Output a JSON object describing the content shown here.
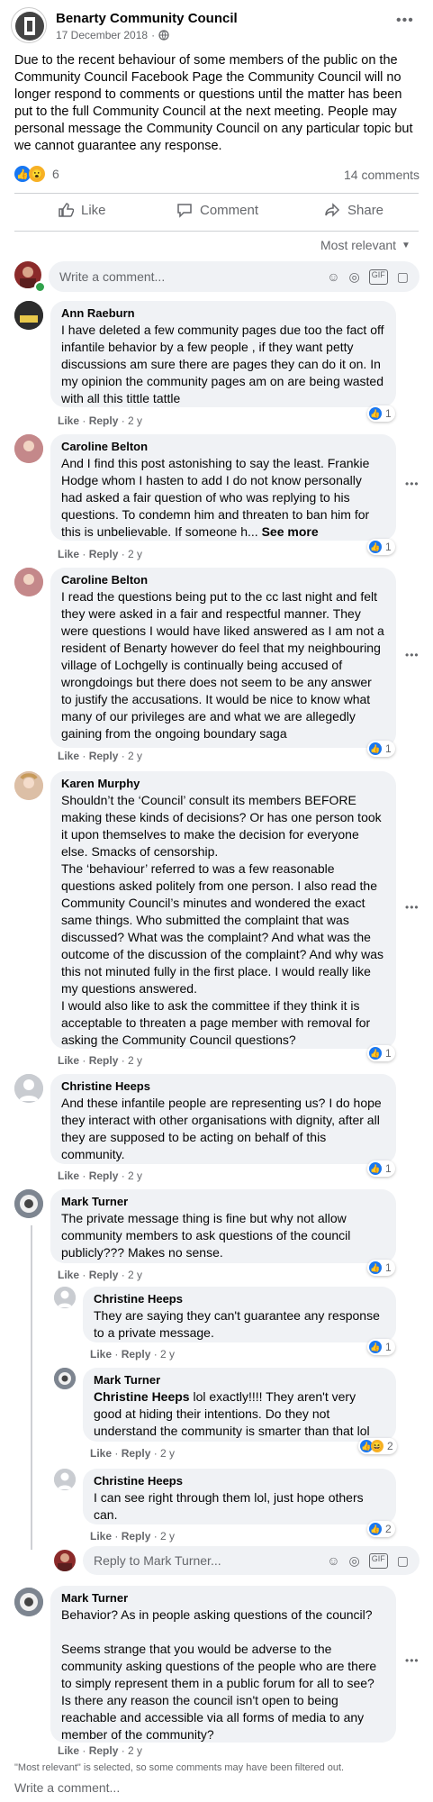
{
  "post": {
    "page_name": "Benarty Community Council",
    "date": "17 December 2018",
    "privacy_icon": "globe-icon",
    "body": "Due to the recent behaviour of some members of the public on the Community Council Facebook Page the Community Council will no longer respond to comments or questions until the matter has been put to the full Community Council at the next meeting. People may personal message the Community Council on any particular topic but we cannot guarantee any response.",
    "reaction_count": "6",
    "comments_count": "14 comments"
  },
  "actions": {
    "like": "Like",
    "comment": "Comment",
    "share": "Share"
  },
  "filter": {
    "label": "Most relevant"
  },
  "composer": {
    "placeholder": "Write a comment..."
  },
  "comments": [
    {
      "name": "Ann Raeburn",
      "text": "I have deleted a few community pages due too the fact off infantile behavior by a few people , if they want petty discussions am sure there are pages they can do it on. In my opinion the community pages am on are being wasted with all this tittle tattle",
      "like": "Like",
      "reply": "Reply",
      "time": "2 y",
      "reacts": "1"
    },
    {
      "name": "Caroline Belton",
      "text": "And I find this post astonishing to say the least. Frankie Hodge whom I hasten to add I do not know personally had asked a fair question of who was replying to his questions. To condemn him and threaten to ban him for this is unbelievable. If someone h...",
      "see_more": "See more",
      "like": "Like",
      "reply": "Reply",
      "time": "2 y",
      "reacts": "1"
    },
    {
      "name": "Caroline Belton",
      "text": "I read the questions being put to the cc last night and felt they were asked in a fair and respectful manner. They were questions I would have liked answered as I am not a resident of Benarty however do feel that my neighbouring village of Lochgelly is continually being accused of wrongdoings but there does not seem to be any answer to justify the accusations. It would be nice to know what many of our privileges are and what we are allegedly gaining from the ongoing boundary saga",
      "like": "Like",
      "reply": "Reply",
      "time": "2 y",
      "reacts": "1"
    },
    {
      "name": "Karen Murphy",
      "text": "Shouldn’t the ‘Council’ consult its members BEFORE making these kinds of decisions? Or has one person took it upon themselves to make the decision for everyone else. Smacks of censorship.\nThe ‘behaviour’ referred to was a few reasonable questions asked politely from one person. I also read the Community Council’s minutes and wondered the exact same things. Who submitted the complaint that was discussed? What was the complaint? And what was the outcome of the discussion of the complaint? And why was this not minuted fully in the first place. I would really like my questions answered.\nI would also like to ask the committee if they think it is acceptable to threaten a page member with removal for asking the Community Council questions?",
      "like": "Like",
      "reply": "Reply",
      "time": "2 y",
      "reacts": "1"
    },
    {
      "name": "Christine Heeps",
      "text": "And these infantile people are representing us? I do hope they interact with other organisations with dignity, after all they are supposed to be acting on behalf of this community.",
      "like": "Like",
      "reply": "Reply",
      "time": "2 y",
      "reacts": "1"
    },
    {
      "name": "Mark Turner",
      "text": "The private message thing is fine but why not allow community members to ask questions of the council publicly??? Makes no sense.",
      "like": "Like",
      "reply": "Reply",
      "time": "2 y",
      "reacts": "1"
    }
  ],
  "replies": [
    {
      "name": "Christine Heeps",
      "text": "They are saying they can't guarantee any response to a private message.",
      "like": "Like",
      "reply": "Reply",
      "time": "2 y",
      "reacts": "1"
    },
    {
      "name": "Mark Turner",
      "mention": "Christine Heeps",
      "text": " lol exactly!!!! They aren't very good at hiding their intentions. Do they not understand the community is smarter than that lol",
      "like": "Like",
      "reply": "Reply",
      "time": "2 y",
      "reacts": "2"
    },
    {
      "name": "Christine Heeps",
      "text": "I can see right through them lol, just hope others can.",
      "like": "Like",
      "reply": "Reply",
      "time": "2 y",
      "reacts": "2"
    }
  ],
  "reply_composer": {
    "placeholder": "Reply to Mark Turner..."
  },
  "last_comment": {
    "name": "Mark Turner",
    "text": "Behavior? As in people asking questions of the council?\n\nSeems strange that you would be adverse to the community asking questions of the people who are there to simply represent them in a public forum for all to see? Is there any reason the council isn't open to being reachable and accessible via all forms of media to any member of the community?",
    "like": "Like",
    "reply": "Reply",
    "time": "2 y"
  },
  "footer": {
    "filter_note": "\"Most relevant\" is selected, so some comments may have been filtered out.",
    "write_comment": "Write a comment..."
  },
  "colors": {
    "accent": "#1877f2",
    "bubble": "#f0f2f5",
    "muted": "#65676b"
  }
}
